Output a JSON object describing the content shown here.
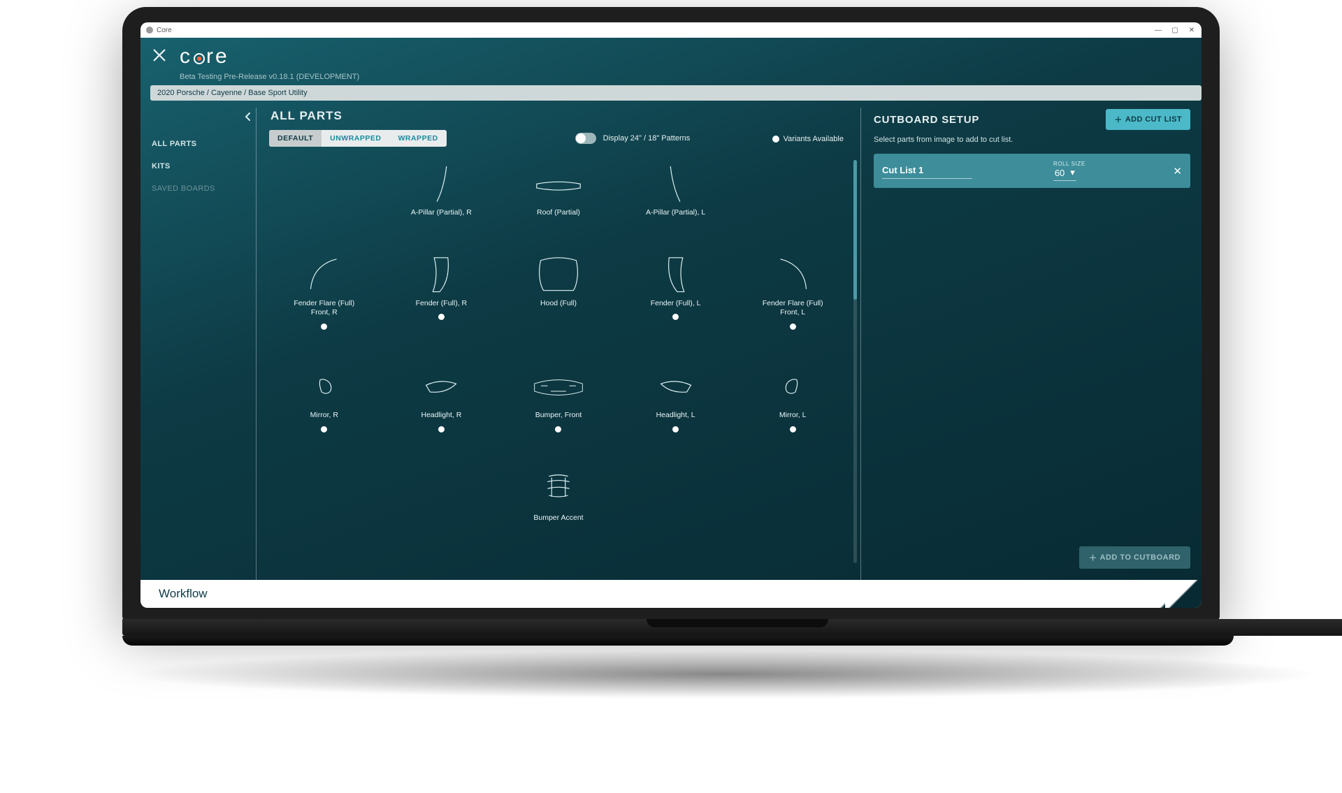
{
  "window": {
    "app_name": "Core"
  },
  "header": {
    "brand": "core",
    "subtitle": "Beta Testing Pre-Release v0.18.1 (DEVELOPMENT)",
    "breadcrumb": "2020 Porsche / Cayenne / Base Sport Utility"
  },
  "sidebar": {
    "items": [
      {
        "label": "ALL PARTS",
        "active": true
      },
      {
        "label": "KITS",
        "active": false
      },
      {
        "label": "SAVED BOARDS",
        "active": false
      }
    ]
  },
  "main": {
    "title": "ALL PARTS",
    "tabs": {
      "default": "DEFAULT",
      "unwrapped": "UNWRAPPED",
      "wrapped": "WRAPPED"
    },
    "toggle_label": "Display 24\" / 18\" Patterns",
    "variants_label": "Variants Available",
    "parts": {
      "row1": [
        {
          "label": "A-Pillar (Partial), R",
          "variant": false
        },
        {
          "label": "Roof (Partial)",
          "variant": false
        },
        {
          "label": "A-Pillar (Partial), L",
          "variant": false
        }
      ],
      "row2": [
        {
          "label": "Fender Flare (Full)\nFront, R",
          "variant": true
        },
        {
          "label": "Fender (Full), R",
          "variant": true
        },
        {
          "label": "Hood (Full)",
          "variant": false
        },
        {
          "label": "Fender (Full), L",
          "variant": true
        },
        {
          "label": "Fender Flare (Full)\nFront, L",
          "variant": true
        }
      ],
      "row3": [
        {
          "label": "Mirror, R",
          "variant": true
        },
        {
          "label": "Headlight, R",
          "variant": true
        },
        {
          "label": "Bumper, Front",
          "variant": true
        },
        {
          "label": "Headlight, L",
          "variant": true
        },
        {
          "label": "Mirror, L",
          "variant": true
        }
      ],
      "row4": [
        {
          "label": "Bumper Accent",
          "variant": false
        }
      ]
    }
  },
  "right": {
    "title": "CUTBOARD SETUP",
    "add_cut_list": "ADD CUT LIST",
    "hint": "Select parts from image to add to cut list.",
    "cutlist": {
      "name": "Cut List 1",
      "roll_label": "ROLL SIZE",
      "roll_value": "60"
    },
    "add_cutboard": "ADD TO CUTBOARD"
  },
  "footer": {
    "workflow": "Workflow"
  }
}
